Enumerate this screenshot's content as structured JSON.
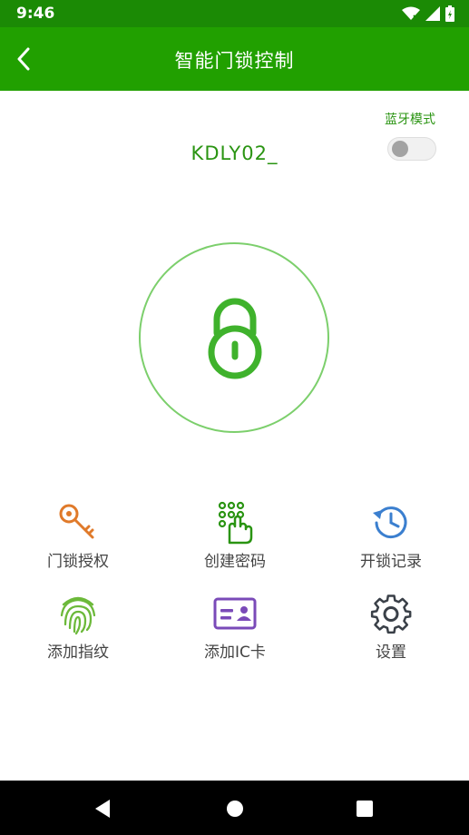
{
  "status_bar": {
    "time": "9:46"
  },
  "app_bar": {
    "title": "智能门锁控制"
  },
  "bluetooth": {
    "label": "蓝牙模式",
    "enabled": false
  },
  "device": {
    "name": "KDLY02_"
  },
  "lock": {
    "state_icon": "padlock-icon"
  },
  "actions": [
    {
      "label": "门锁授权",
      "icon": "key-icon",
      "color": "#e07a2a"
    },
    {
      "label": "创建密码",
      "icon": "keypad-hand-icon",
      "color": "#2a9412"
    },
    {
      "label": "开锁记录",
      "icon": "history-clock-icon",
      "color": "#3b7fcf"
    },
    {
      "label": "添加指纹",
      "icon": "fingerprint-icon",
      "color": "#6cb93a"
    },
    {
      "label": "添加IC卡",
      "icon": "id-card-icon",
      "color": "#7a4ab8"
    },
    {
      "label": "设置",
      "icon": "gear-icon",
      "color": "#3a4048"
    }
  ],
  "colors": {
    "primary": "#21a000",
    "status_bar": "#1b8a05",
    "accent_text": "#2a9412"
  }
}
